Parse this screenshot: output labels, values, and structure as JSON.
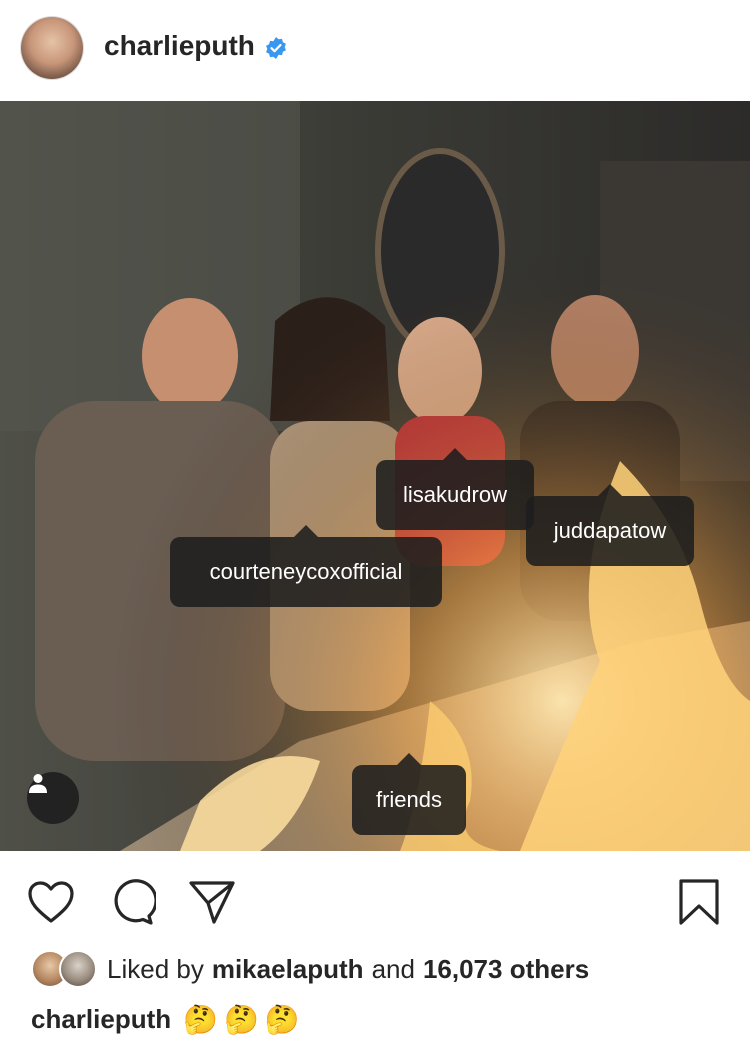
{
  "header": {
    "username": "charlieputh",
    "verified_icon": "verified-badge-icon",
    "more_icon": "more-options-icon"
  },
  "photo": {
    "tags": [
      {
        "label": "lisakudrow"
      },
      {
        "label": "juddapatow"
      },
      {
        "label": "courteneycoxofficial"
      },
      {
        "label": "friends"
      }
    ],
    "tag_user_icon": "person-icon"
  },
  "actions": {
    "like_icon": "heart-icon",
    "comment_icon": "comment-icon",
    "share_icon": "send-icon",
    "save_icon": "bookmark-icon"
  },
  "likes": {
    "prefix": "Liked by",
    "user": "mikaelaputh",
    "connector": "and",
    "count": "16,073 others"
  },
  "caption": {
    "username": "charlieputh",
    "emojis": [
      "🤔",
      "🤔",
      "🤔"
    ]
  },
  "colors": {
    "text": "#262626",
    "verified": "#3897f0",
    "tag_bg": "#1e1e1e"
  }
}
